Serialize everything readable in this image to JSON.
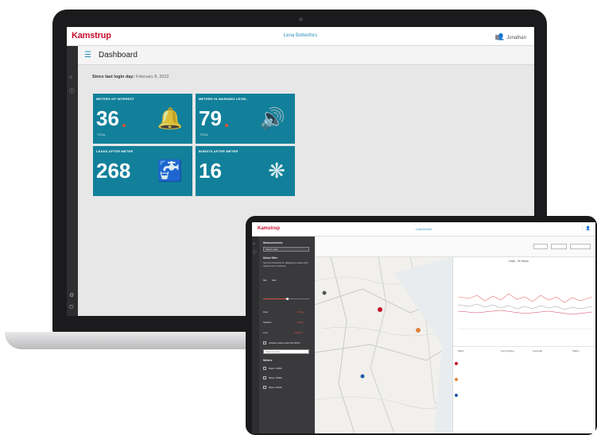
{
  "laptop": {
    "brand": "Kamstrup",
    "header_center": "Lena Bottenfors",
    "user_label": "Jonathan",
    "dashboard_title": "Dashboard",
    "last_login_label": "Since last login day:",
    "last_login_date": "February 8, 2022",
    "tiles": [
      {
        "title": "METERS OF INTEREST",
        "value": "36",
        "sub": "TOTAL",
        "icon": "bell-icon",
        "glyph": "🔔"
      },
      {
        "title": "METERS IN WARNING LEVEL",
        "value": "79",
        "sub": "TOTAL",
        "icon": "speaker-icon",
        "glyph": "🔊"
      },
      {
        "title": "LEAKS AFTER METER",
        "value": "268",
        "sub": "",
        "icon": "faucet-icon",
        "glyph": "🚰"
      },
      {
        "title": "BURSTS AFTER METER",
        "value": "16",
        "sub": "",
        "icon": "burst-icon",
        "glyph": "❋"
      }
    ],
    "colors": {
      "tile": "#12809a",
      "brand": "#c8102e",
      "accent": "#2a8fb8"
    }
  },
  "tablet": {
    "brand": "Kamstrup",
    "header_center": "Leak Monitor",
    "panel": {
      "section_title": "Measurements",
      "select_value": "Select area",
      "filter_title": "Noise filter",
      "description": "Set the threshold for displayed meters with noise level of interest",
      "min_label": "Min",
      "max_label": "Max",
      "rows": [
        {
          "label": "Flow",
          "value": "Active"
        },
        {
          "label": "Medium",
          "value": "Active"
        },
        {
          "label": "Low",
          "value": "Inactive"
        }
      ],
      "toggle_label": "Include meters with NO DATA",
      "search_placeholder": "Search meter",
      "list_title": "Meters",
      "list_items": [
        "Meter 14521",
        "Meter 10283",
        "Meter 10911"
      ]
    },
    "graph": {
      "title": "Leak - 24 Hours",
      "table_headers": [
        "Meter",
        "Last reading",
        "Last leak",
        "Status"
      ]
    }
  }
}
